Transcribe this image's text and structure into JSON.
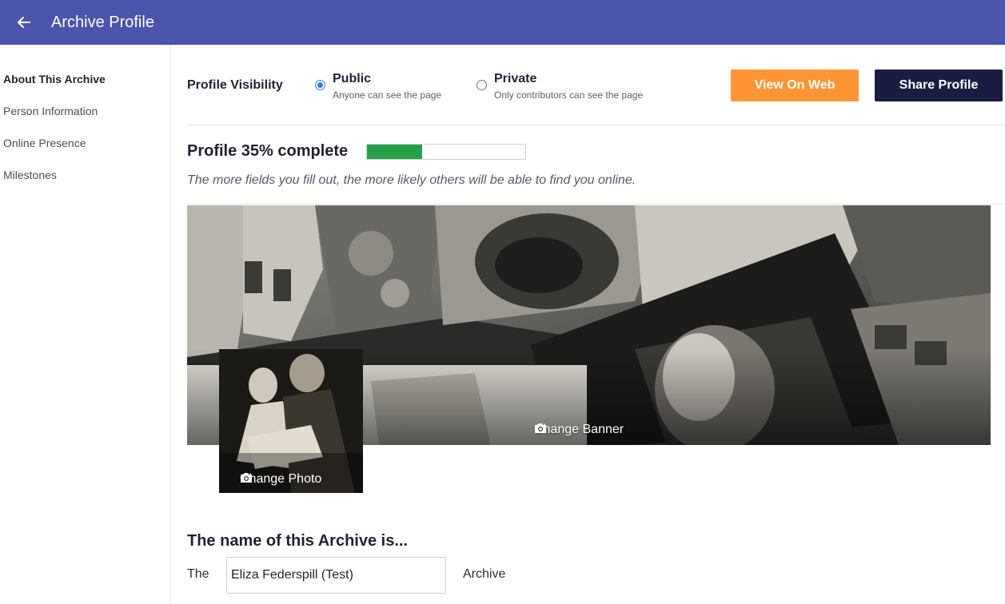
{
  "header": {
    "title": "Archive Profile",
    "back_icon": "arrow-left-icon",
    "color": "#4a55ad"
  },
  "sidebar": {
    "items": [
      {
        "label": "About This Archive",
        "active": true
      },
      {
        "label": "Person Information",
        "active": false
      },
      {
        "label": "Online Presence",
        "active": false
      },
      {
        "label": "Milestones",
        "active": false
      }
    ]
  },
  "visibility": {
    "label": "Profile Visibility",
    "options": [
      {
        "title": "Public",
        "subtitle": "Anyone can see the page",
        "selected": true
      },
      {
        "title": "Private",
        "subtitle": "Only contributors can see the page",
        "selected": false
      }
    ]
  },
  "actions": {
    "view_on_web": "View On Web",
    "share_profile": "Share Profile",
    "view_color": "#ff9433",
    "share_color": "#191d42"
  },
  "completion": {
    "title": "Profile 35% complete",
    "percent": 35,
    "hint": "The more fields you fill out, the more likely others will be able to find you online.",
    "bar_color": "#26a147"
  },
  "banner": {
    "change_label": "Change Banner",
    "icon": "camera-icon"
  },
  "photo": {
    "change_label": "Change Photo",
    "icon": "camera-icon"
  },
  "archive_name": {
    "heading": "The name of this Archive is...",
    "prefix": "The",
    "value": "Eliza Federspill (Test)",
    "suffix": "Archive"
  }
}
